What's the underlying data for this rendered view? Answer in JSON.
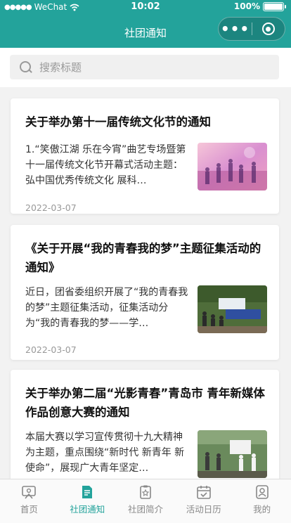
{
  "status_bar": {
    "carrier": "WeChat",
    "time": "10:02",
    "battery": "100%"
  },
  "nav": {
    "title": "社团通知"
  },
  "search": {
    "placeholder": "搜索标题"
  },
  "articles": [
    {
      "title": "关于举办第十一届传统文化节的通知",
      "summary": "1.“笑傲江湖 乐在今宵”曲艺专场暨第十一届传统文化节开幕式活动主题：弘中国优秀传统文化 展科…",
      "date": "2022-03-07"
    },
    {
      "title": "《关于开展“我的青春我的梦”主题征集活动的通知》",
      "summary": "近日，团省委组织开展了“我的青春我的梦”主题征集活动，征集活动分为“我的青春我的梦——学…",
      "date": "2022-03-07"
    },
    {
      "title": "关于举办第二届“光影青春”青岛市 青年新媒体作品创意大赛的通知",
      "summary": "本届大赛以学习宣传贯彻十九大精神为主题，重点围绕“新时代 新青年 新使命”，展现广大青年坚定…",
      "date": ""
    }
  ],
  "tabbar": {
    "items": [
      {
        "label": "首页",
        "icon": "home-icon",
        "active": false
      },
      {
        "label": "社团通知",
        "icon": "notice-icon",
        "active": true
      },
      {
        "label": "社团简介",
        "icon": "intro-icon",
        "active": false
      },
      {
        "label": "活动日历",
        "icon": "calendar-icon",
        "active": false
      },
      {
        "label": "我的",
        "icon": "user-icon",
        "active": false
      }
    ]
  },
  "colors": {
    "accent": "#23a39b"
  }
}
